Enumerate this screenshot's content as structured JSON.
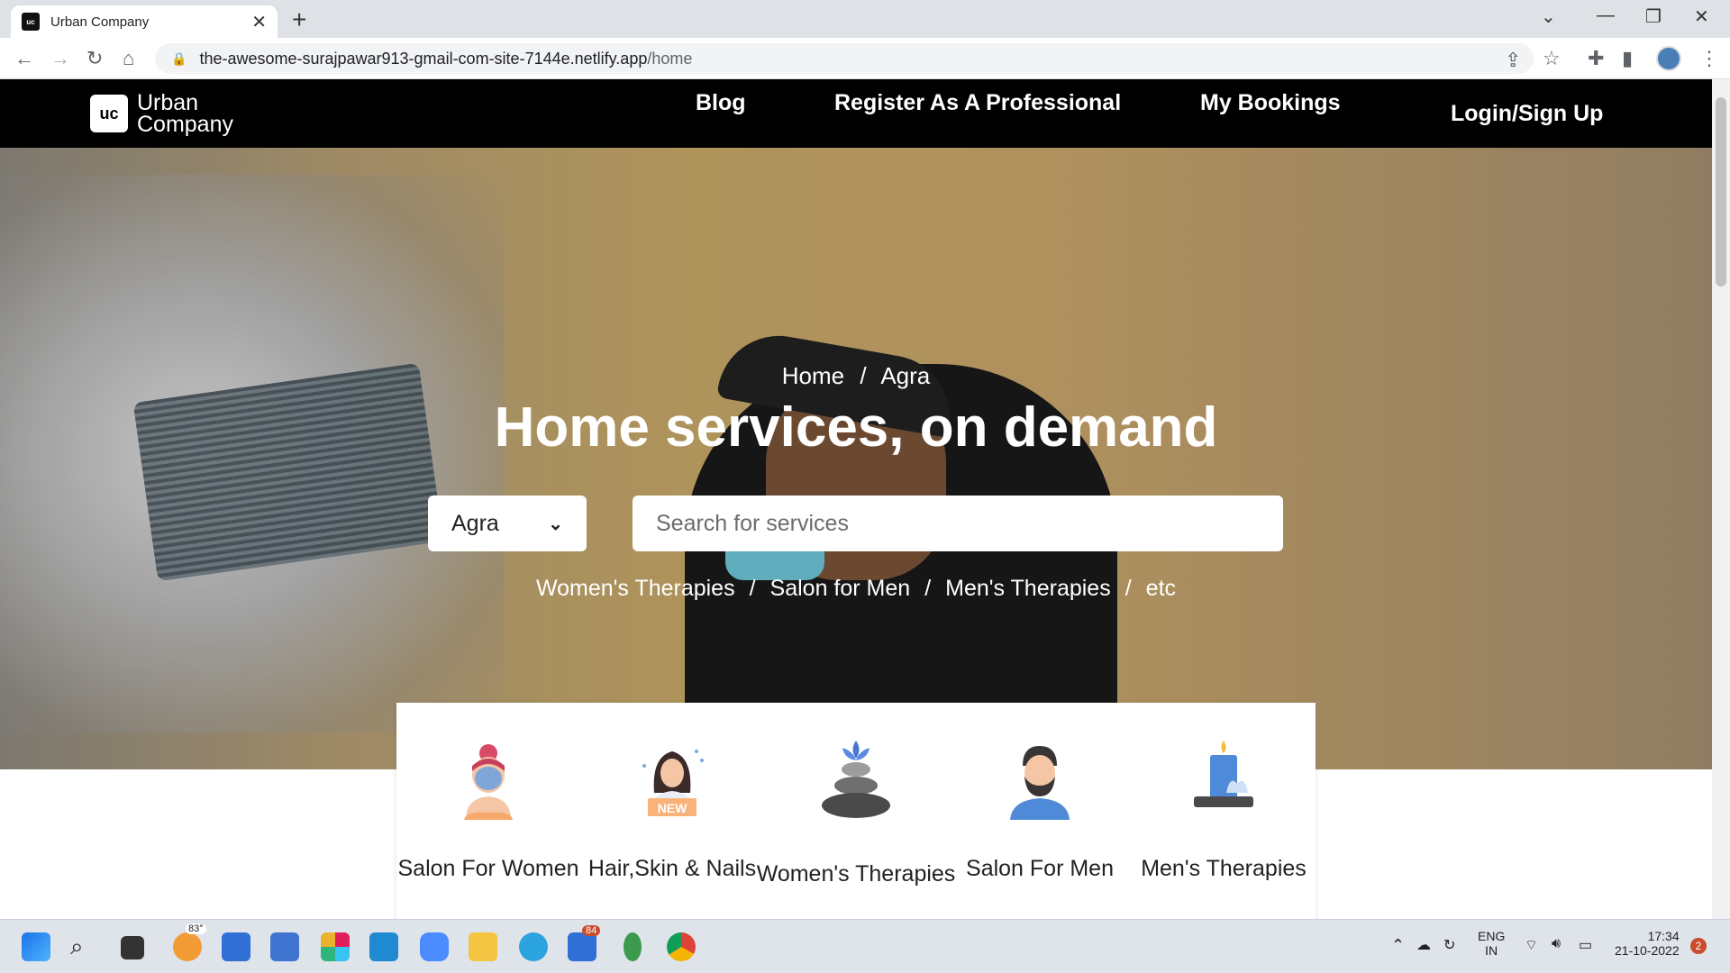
{
  "browser": {
    "tab_title": "Urban Company",
    "tab_favicon_text": "uc",
    "url_host": "the-awesome-surajpawar913-gmail-com-site-7144e.netlify.app",
    "url_path": "/home"
  },
  "nav": {
    "logo_mark": "uc",
    "logo_line1": "Urban",
    "logo_line2": "Company",
    "links": [
      "Blog",
      "Register As A Professional",
      "My Bookings",
      "Login/Sign Up"
    ]
  },
  "hero": {
    "breadcrumb_home": "Home",
    "breadcrumb_sep": "/",
    "breadcrumb_city": "Agra",
    "title": "Home services, on demand",
    "city_value": "Agra",
    "search_placeholder": "Search for services",
    "quick_links": [
      "Women's Therapies",
      "Salon for Men",
      "Men's Therapies",
      "etc"
    ]
  },
  "categories": [
    {
      "label": "Salon For Women",
      "icon": "woman-face-mask-icon"
    },
    {
      "label": "Hair,Skin & Nails",
      "icon": "woman-new-badge-icon",
      "badge": "NEW"
    },
    {
      "label": "Women's Therapies",
      "icon": "spa-stones-icon"
    },
    {
      "label": "Salon For Men",
      "icon": "bearded-man-icon"
    },
    {
      "label": "Men's Therapies",
      "icon": "candle-lotus-icon"
    }
  ],
  "taskbar": {
    "weather_badge": "83°",
    "telegram_badge": "84",
    "lang_line1": "ENG",
    "lang_line2": "IN",
    "time": "17:34",
    "date": "21-10-2022",
    "notification_count": "2"
  }
}
